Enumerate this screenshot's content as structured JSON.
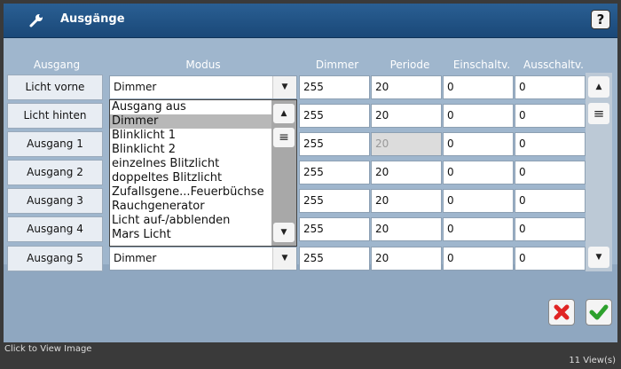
{
  "window": {
    "title": "Ausgänge"
  },
  "headers": [
    "Ausgang",
    "Modus",
    "Dimmer",
    "Periode",
    "Einschaltv.",
    "Ausschaltv."
  ],
  "rows": [
    {
      "label": "Licht vorne",
      "mode": "Dimmer",
      "dimmer": "255",
      "periode": "20",
      "ein": "0",
      "aus": "0"
    },
    {
      "label": "Licht hinten",
      "mode": "",
      "dimmer": "255",
      "periode": "20",
      "ein": "0",
      "aus": "0"
    },
    {
      "label": "Ausgang 1",
      "mode": "",
      "dimmer": "255",
      "periode": "20",
      "ein": "0",
      "aus": "0"
    },
    {
      "label": "Ausgang 2",
      "mode": "",
      "dimmer": "255",
      "periode": "20",
      "ein": "0",
      "aus": "0"
    },
    {
      "label": "Ausgang 3",
      "mode": "",
      "dimmer": "255",
      "periode": "20",
      "ein": "0",
      "aus": "0"
    },
    {
      "label": "Ausgang 4",
      "mode": "",
      "dimmer": "255",
      "periode": "20",
      "ein": "0",
      "aus": "0"
    },
    {
      "label": "Ausgang 5",
      "mode": "Dimmer",
      "dimmer": "255",
      "periode": "20",
      "ein": "0",
      "aus": "0"
    }
  ],
  "dropdown": {
    "options": [
      "Ausgang aus",
      "Dimmer",
      "Blinklicht 1",
      "Blinklicht 2",
      "einzelnes Blitzlicht",
      "doppeltes Blitzlicht",
      "Zufallsgene...Feuerbüchse",
      "Rauchgenerator",
      "Licht auf-/abblenden",
      "Mars Licht"
    ],
    "selected": "Dimmer"
  },
  "status": {
    "left": "Click to View Image",
    "right": "11 View(s)"
  },
  "colors": {
    "titlebar": "#1f5288",
    "cancel": "#e02424",
    "ok": "#2da12d"
  },
  "icons": {
    "title": "wrench-icon",
    "help": "help-icon",
    "cancel": "x-icon",
    "ok": "checkmark-icon"
  }
}
